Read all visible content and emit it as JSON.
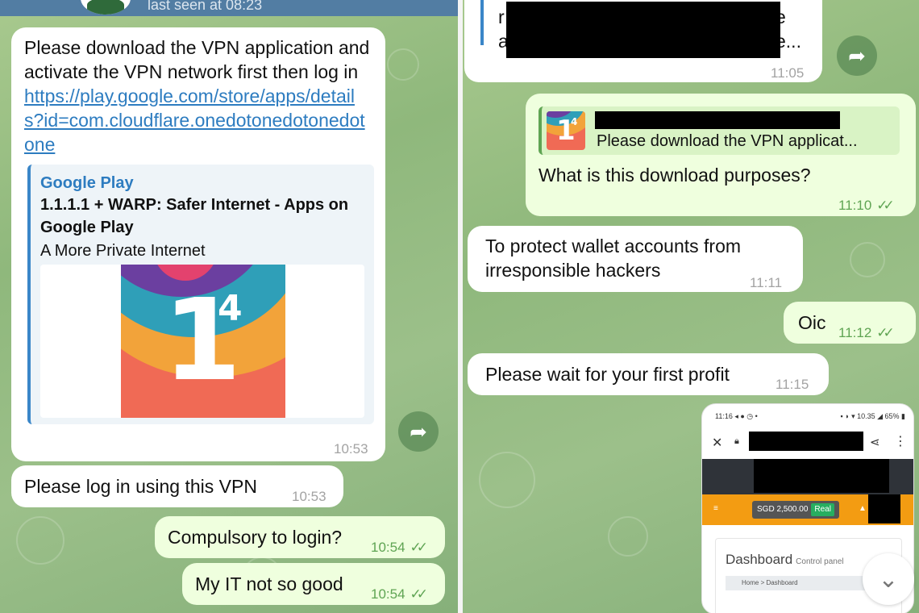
{
  "left": {
    "header": {
      "status": "last seen at 08:23"
    },
    "msg1": {
      "text": "Please download the VPN application and activate the VPN network first then log in",
      "link": "https://play.google.com/store/apps/details?id=com.cloudflare.onedotonedotonedotone",
      "preview": {
        "site": "Google Play",
        "title": "1.1.1.1 + WARP: Safer Internet - Apps on Google Play",
        "description": "A More Private Internet",
        "logo_text": "1",
        "logo_sup": "4"
      },
      "time": "10:53"
    },
    "msg2": {
      "text": "Please log in using this VPN",
      "time": "10:53"
    },
    "msg3": {
      "text": "Compulsory to login?",
      "time": "10:54"
    },
    "msg4": {
      "text": "My IT not so good",
      "time": "10:54"
    }
  },
  "right": {
    "msg0": {
      "time": "11:05",
      "visible_fragments": [
        "r",
        "a",
        "e",
        "e..."
      ]
    },
    "msg1": {
      "quote_text": "Please download the VPN applicat...",
      "text": "What is this download purposes?",
      "time": "11:10"
    },
    "msg2": {
      "text": "To protect wallet accounts from irresponsible hackers",
      "time": "11:11"
    },
    "msg3": {
      "text": "Oic",
      "time": "11:12"
    },
    "msg4": {
      "text": "Please wait for your first profit",
      "time": "11:15"
    },
    "screenshot": {
      "status_left": "11:16 ◂ ● ◷ •",
      "status_right": "▪ ◗ ▾ 10.35 ◢ 65% ▮",
      "balance": "SGD 2,500.00",
      "balance_badge": "Real",
      "title": "Dashboard",
      "subtitle": "Control panel",
      "breadcrumb": "Home  >  Dashboard"
    }
  },
  "ticks": "✓✓",
  "icons": {
    "forward": "forward-arrow-icon",
    "scroll": "chevron-down-icon"
  },
  "colors": {
    "incoming_bubble": "#ffffff",
    "outgoing_bubble": "#efffde",
    "link": "#2d7cc0",
    "accent_green": "#5fa453",
    "chat_bg": "#9cc08a"
  }
}
